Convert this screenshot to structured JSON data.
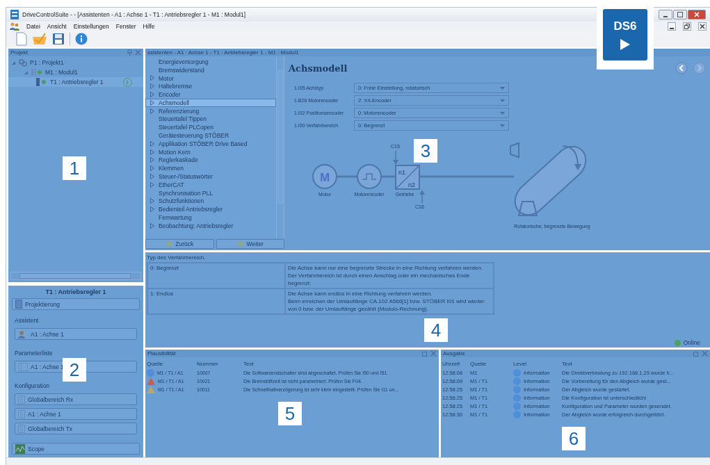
{
  "window": {
    "title": "DriveControlSuite -  - [Assistenten - A1 : Achse 1 - T1 : Antriebsregler 1 - M1 : Modul1]"
  },
  "logo": {
    "text": "DS6"
  },
  "menu": [
    "Datei",
    "Ansicht",
    "Einstellungen",
    "Fenster",
    "Hilfe"
  ],
  "project_panel": {
    "title": "Projekt",
    "tree": [
      {
        "label": "P1 : Projekt1",
        "kind": "project",
        "expanded": true,
        "children": [
          {
            "label": "M1 : Modul1",
            "kind": "module",
            "expanded": true,
            "children": [
              {
                "label": "T1 : Antriebsregler 1",
                "kind": "drive",
                "badge": "1",
                "selected": true
              }
            ]
          }
        ]
      }
    ]
  },
  "drive_panel": {
    "title": "T1 : Antriebsregler 1",
    "top_button": "Projektierung",
    "groups": [
      {
        "label": "Assistent",
        "buttons": [
          {
            "label": "A1 : Achse 1",
            "kind": "assistant"
          }
        ]
      },
      {
        "label": "Parameterliste",
        "buttons": [
          {
            "label": "A1 : Achse 1",
            "kind": "list"
          }
        ]
      },
      {
        "label": "Konfiguration",
        "buttons": [
          {
            "label": "Globalbereich Rx",
            "kind": "config"
          },
          {
            "label": "A1 : Achse 1",
            "kind": "config"
          },
          {
            "label": "Globalbereich Tx",
            "kind": "config"
          }
        ]
      }
    ],
    "bottom_button": "Scope"
  },
  "assistant": {
    "title": "ssistenten - A1 : Achse 1 - T1 : Antriebsregler 1 - M1 : Modul1",
    "nav": [
      {
        "label": "Energieversorgung",
        "expandable": false,
        "selected": false
      },
      {
        "label": "Bremswiderstand",
        "expandable": false,
        "selected": false
      },
      {
        "label": "Motor",
        "expandable": true,
        "selected": false
      },
      {
        "label": "Haltebremse",
        "expandable": true,
        "selected": false
      },
      {
        "label": "Encoder",
        "expandable": true,
        "selected": false
      },
      {
        "label": "Achsmodell",
        "expandable": true,
        "selected": true
      },
      {
        "label": "Referenzierung",
        "expandable": true,
        "selected": false
      },
      {
        "label": "Steuertafel Tippen",
        "expandable": false,
        "selected": false
      },
      {
        "label": "Steuertafel PLCopen",
        "expandable": false,
        "selected": false
      },
      {
        "label": "Gerätesteuerung STÖBER",
        "expandable": false,
        "selected": false
      },
      {
        "label": "Applikation STÖBER Drive Based",
        "expandable": true,
        "selected": false
      },
      {
        "label": "Motion Kern",
        "expandable": true,
        "selected": false
      },
      {
        "label": "Reglerkaskade",
        "expandable": true,
        "selected": false
      },
      {
        "label": "Klemmen",
        "expandable": true,
        "selected": false
      },
      {
        "label": "Steuer-/Statuswörter",
        "expandable": true,
        "selected": false
      },
      {
        "label": "EtherCAT",
        "expandable": true,
        "selected": false
      },
      {
        "label": "Synchronisation PLL",
        "expandable": false,
        "selected": false
      },
      {
        "label": "Schutzfunktionen",
        "expandable": true,
        "selected": false
      },
      {
        "label": "Bedienteil Antriebsregler",
        "expandable": true,
        "selected": false
      },
      {
        "label": "Fernwartung",
        "expandable": false,
        "selected": false
      },
      {
        "label": "Beobachtung: Antriebsregler",
        "expandable": true,
        "selected": false
      }
    ],
    "back_button": "Zurück",
    "next_button": "Weiter",
    "heading": "Achsmodell",
    "params": [
      {
        "label": "1.I05 Achstyp",
        "value": "0: Freie Einstellung, rotatorisch"
      },
      {
        "label": "1.B26 Motorencoder",
        "value": "2: X4-Encoder"
      },
      {
        "label": "1.I02 Positionsencoder",
        "value": "0: Motorencoder"
      },
      {
        "label": "1.I00 Verfahrbereich",
        "value": "0: Begrenzt"
      }
    ],
    "diagram": {
      "motor_symbol": "M",
      "motor": "Motor",
      "encoder": "Motorencoder",
      "gear": "Getriebe",
      "gear_in": "n1",
      "gear_out": "n2",
      "top_param": "C15",
      "bottom_param": "C16",
      "load": "Rotatorische, begrenzte Bewegung"
    }
  },
  "help": {
    "title": "Typ des Verfahrbereich.",
    "rows": [
      {
        "value": "0: Begrenzt",
        "lines": [
          "Die Achse kann nur eine begrenzte Strecke in eine Richtung verfahren werden.",
          "Der Verfahrbereich ist durch einen Anschlag oder ein mechanisches Ende begrenzt."
        ]
      },
      {
        "value": "1: Endlos",
        "lines": [
          "Die Achse kann endlos in eine Richtung verfahren werden.",
          "Beim erreichen der Umlauflänge CA.102 A566[1] bzw. STÖBER I01 wird wieder von 0 bzw. der Umlauflänge gezählt (Modulo-Rechnung)."
        ]
      }
    ],
    "status": "Online"
  },
  "plausibility": {
    "title": "Plausibilität",
    "columns": [
      "Quelle",
      "Nummer",
      "Text"
    ],
    "rows": [
      {
        "kind": "info",
        "source": "M1 / T1 / A1",
        "number": "10007",
        "text": "Die Softwareendschalter sind abgeschaltet. Prüfen Sie I50 und I51."
      },
      {
        "kind": "error",
        "source": "M1 / T1 / A1",
        "number": "10021",
        "text": "Die Bremslüftzeit ist nicht parametriert. Prüfen Sie F04."
      },
      {
        "kind": "warning",
        "source": "M1 / T1 / A1",
        "number": "10011",
        "text": "Die Schnellhaltverzögerung ist sehr klein eingestellt. Prüfen Sie I11 un..."
      }
    ]
  },
  "output": {
    "title": "Ausgabe",
    "columns": [
      "Uhrzeit",
      "Quelle",
      "Level",
      "Text"
    ],
    "rows": [
      {
        "time": "12:58:08",
        "source": "M1",
        "level": "Information",
        "text": "Die Direktverbindung zu 192.168.1.29 wurde h..."
      },
      {
        "time": "12:58:09",
        "source": "M1 / T1",
        "level": "Information",
        "text": "Die Vorbereitung für den Abgleich wurde gest..."
      },
      {
        "time": "12:58:25",
        "source": "M1 / T1",
        "level": "Information",
        "text": "Der Abgleich wurde gestartet."
      },
      {
        "time": "12:58:25",
        "source": "M1 / T1",
        "level": "Information",
        "text": "Die Konfiguration ist unterschiedlich!"
      },
      {
        "time": "12:58:25",
        "source": "M1 / T1",
        "level": "Information",
        "text": "Konfiguration und Parameter wurden gesendet."
      },
      {
        "time": "12:58:30",
        "source": "M1 / T1",
        "level": "Information",
        "text": "Der Abgleich wurde erfolgreich durchgeführt."
      }
    ]
  },
  "callouts": [
    "1",
    "2",
    "3",
    "4",
    "5",
    "6"
  ]
}
